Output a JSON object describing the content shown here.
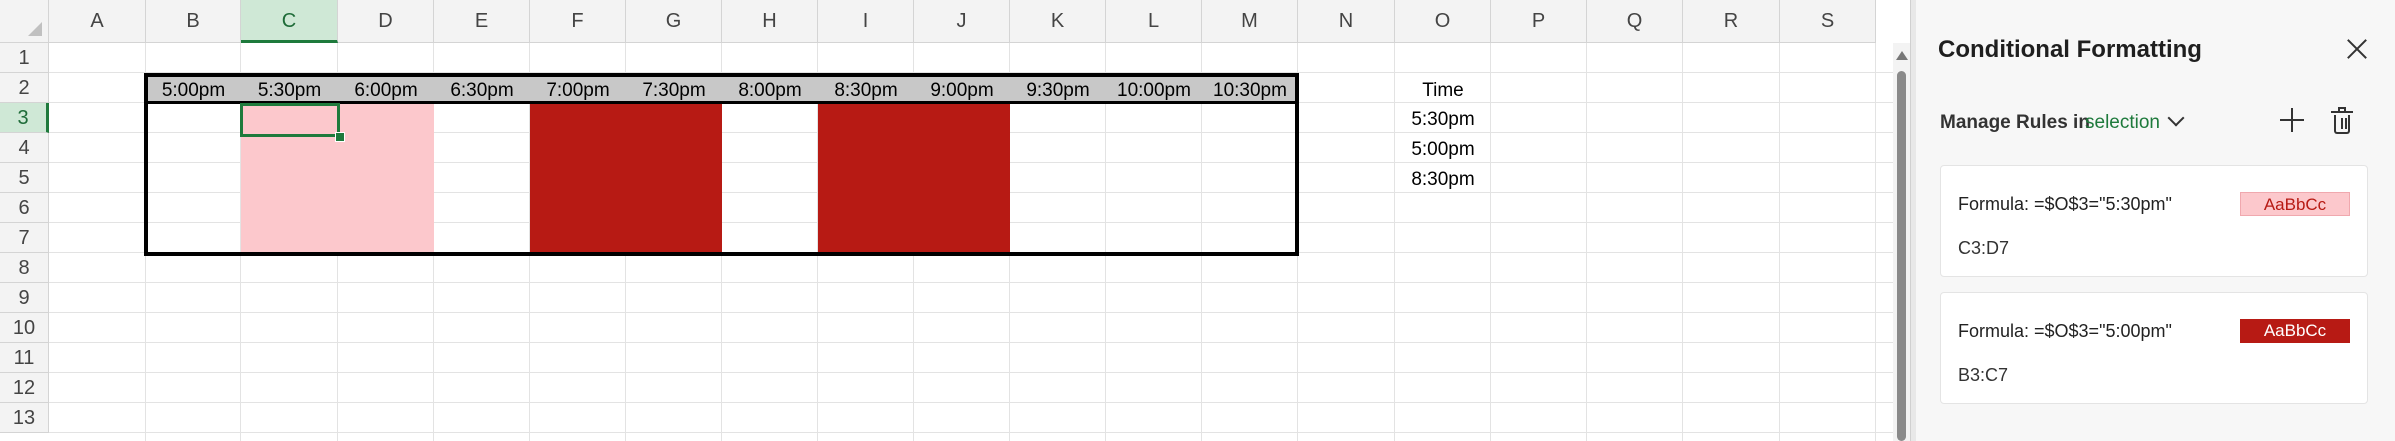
{
  "grid": {
    "columns": [
      "A",
      "B",
      "C",
      "D",
      "E",
      "F",
      "G",
      "H",
      "I",
      "J",
      "K",
      "L",
      "M",
      "N",
      "O",
      "P",
      "Q",
      "R",
      "S"
    ],
    "rows": [
      "1",
      "2",
      "3",
      "4",
      "5",
      "6",
      "7",
      "8",
      "9",
      "10",
      "11",
      "12",
      "13"
    ],
    "selected_cell": "C3",
    "time_headers": [
      "5:00pm",
      "5:30pm",
      "6:00pm",
      "6:30pm",
      "7:00pm",
      "7:30pm",
      "8:00pm",
      "8:30pm",
      "9:00pm",
      "9:30pm",
      "10:00pm",
      "10:30pm"
    ],
    "time_column": {
      "label": "Time",
      "values": [
        "5:30pm",
        "5:00pm",
        "8:30pm"
      ]
    },
    "colors": {
      "header_fill": "#c8c8c8",
      "light_fill": "#fcc8cc",
      "dark_fill": "#b71a14",
      "selection": "#1e7a3c"
    }
  },
  "panel": {
    "title": "Conditional Formatting",
    "manage_label": "Manage Rules in",
    "manage_value": "selection",
    "rules": [
      {
        "formula": "Formula: =$O$3=\"5:30pm\"",
        "range": "C3:D7",
        "preview": "AaBbCc",
        "bg": "#fcc8cc",
        "fg": "#b71a14"
      },
      {
        "formula": "Formula: =$O$3=\"5:00pm\"",
        "range": "B3:C7",
        "preview": "AaBbCc",
        "bg": "#b71a14",
        "fg": "#ffffff"
      }
    ]
  }
}
